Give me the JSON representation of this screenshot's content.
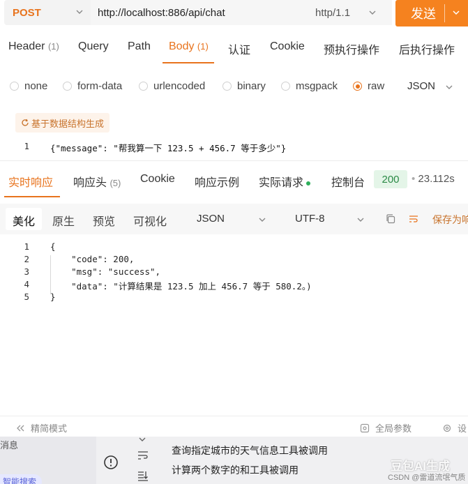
{
  "url_bar": {
    "method": "POST",
    "url": "http://localhost:886/api/chat",
    "protocol": "http/1.1",
    "send_label": "发送"
  },
  "request_tabs": [
    {
      "label": "Header",
      "count": "(1)"
    },
    {
      "label": "Query",
      "count": ""
    },
    {
      "label": "Path",
      "count": ""
    },
    {
      "label": "Body",
      "count": "(1)",
      "active": true
    },
    {
      "label": "认证",
      "count": ""
    },
    {
      "label": "Cookie",
      "count": ""
    },
    {
      "label": "预执行操作",
      "count": ""
    },
    {
      "label": "后执行操作",
      "count": ""
    }
  ],
  "body_types": [
    "none",
    "form-data",
    "urlencoded",
    "binary",
    "msgpack",
    "raw"
  ],
  "body_type_selected": "raw",
  "body_format": "JSON",
  "generate_label": "基于数据结构生成",
  "request_code": {
    "line_number": "1",
    "text": "{\"message\": \"帮我算一下 123.5 + 456.7 等于多少\"}"
  },
  "response_tabs": [
    {
      "label": "实时响应",
      "count": "",
      "active": true
    },
    {
      "label": "响应头",
      "count": "(5)"
    },
    {
      "label": "Cookie",
      "count": ""
    },
    {
      "label": "响应示例",
      "count": ""
    },
    {
      "label": "实际请求",
      "count": ""
    },
    {
      "label": "控制台",
      "count": ""
    }
  ],
  "status_code": "200",
  "response_time": "23.112s",
  "view_tabs": [
    "美化",
    "原生",
    "预览",
    "可视化"
  ],
  "response_format": "JSON",
  "response_encoding": "UTF-8",
  "save_response_label": "保存为响",
  "response_code": {
    "line_numbers": [
      "1",
      "2",
      "3",
      "4",
      "5"
    ],
    "lines": [
      "{",
      "    \"code\": 200,",
      "    \"msg\": \"success\",",
      "    \"data\": \"计算结果是 123.5 加上 456.7 等于 580.2。)",
      "}"
    ]
  },
  "footer": {
    "compact_mode": "精简模式",
    "global_params": "全局参数",
    "settings": "设"
  },
  "bottom_panel": {
    "left_text": "消息",
    "pill_text": "智能搜索",
    "message_1": "查询指定城市的天气信息工具被调用",
    "message_2": "计算两个数字的和工具被调用",
    "watermark": "豆包AI生成",
    "watermark_small": "CSDN @雷道流氓气质"
  },
  "colors": {
    "accent": "#e8731d",
    "send_bg": "#f5821f",
    "status_bg": "#e4f5e8",
    "status_text": "#2b8a46",
    "online_dot": "#2eae5b"
  }
}
